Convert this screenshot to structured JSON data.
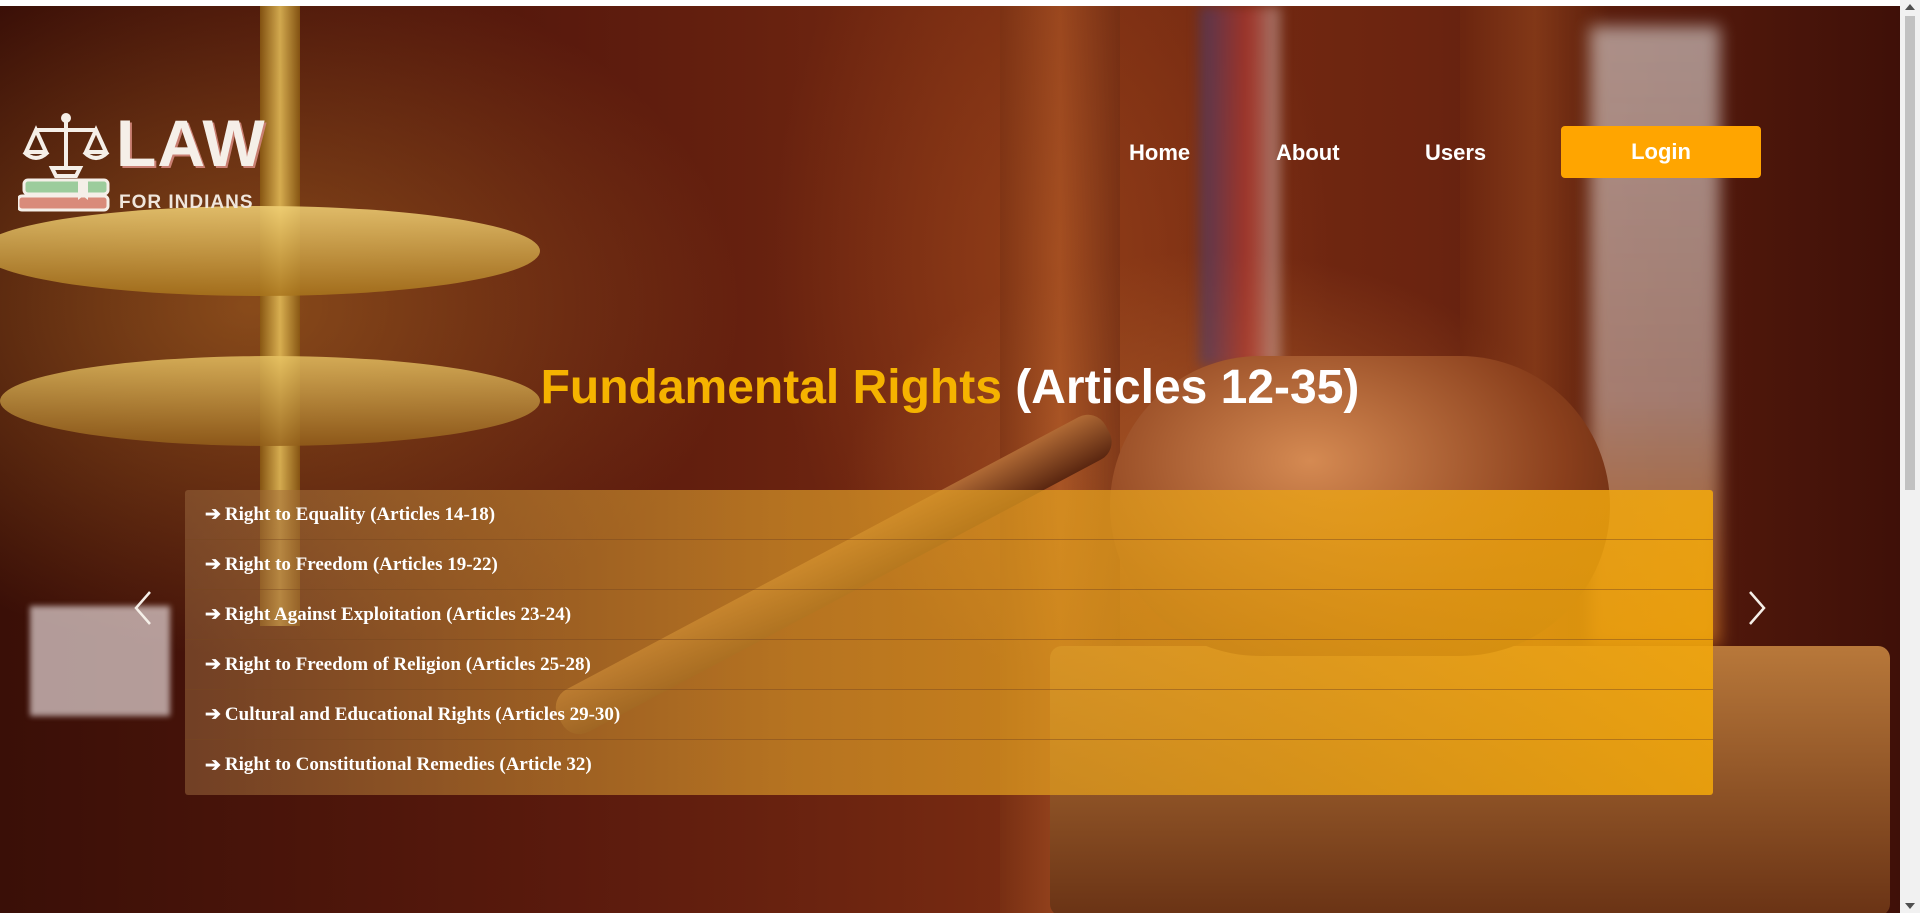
{
  "brand": {
    "title": "LAW",
    "subtitle": "FOR INDIANS",
    "icon": "scales-books-icon"
  },
  "nav": {
    "home": "Home",
    "about": "About",
    "users": "Users",
    "login": "Login"
  },
  "headline": {
    "accent": "Fundamental Rights",
    "rest": " (Articles 12-35)"
  },
  "rights": [
    "Right to Equality (Articles 14-18)",
    "Right to Freedom (Articles 19-22)",
    " Right Against Exploitation (Articles 23-24)",
    " Right to Freedom of Religion (Articles 25-28)",
    " Cultural and Educational Rights (Articles 29-30)",
    " Right to Constitutional Remedies (Article 32)"
  ],
  "icons": {
    "arrow": "arrow-right-icon",
    "prev": "chevron-left-icon",
    "next": "chevron-right-icon"
  },
  "colors": {
    "accent": "#ffa500",
    "headline_accent": "#f5b300"
  }
}
